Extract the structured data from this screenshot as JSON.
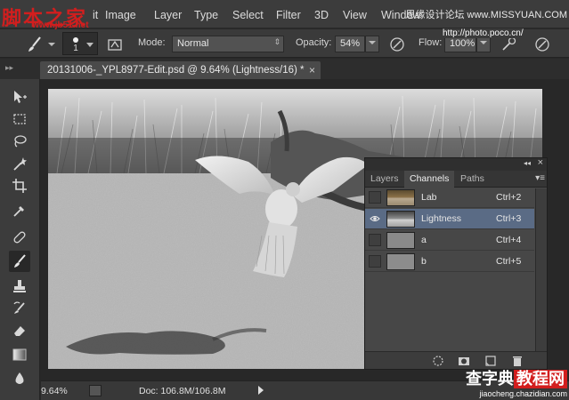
{
  "watermark": {
    "logo": "脚本之家",
    "url": "www.jb51.net",
    "top_right": "思缘设计论坛 www.MISSYUAN.COM",
    "bottom_big_prefix": "查字典",
    "bottom_big_highlight": "教程网",
    "bottom_small": "jiaocheng.chazidian.com"
  },
  "menu": {
    "items": [
      "it",
      "Image",
      "Layer",
      "Type",
      "Select",
      "Filter",
      "3D",
      "View",
      "Window"
    ]
  },
  "options": {
    "brush_size": "1",
    "mode_label": "Mode:",
    "mode_value": "Normal",
    "opacity_label": "Opacity:",
    "opacity_value": "54%",
    "flow_label": "Flow:",
    "flow_value": "100%",
    "photo_url": "http://photo.poco.cn/"
  },
  "document": {
    "tab_title": "20131006-_YPL8977-Edit.psd @ 9.64% (Lightness/16) *",
    "close": "×"
  },
  "status": {
    "zoom": "9.64%",
    "doc_info": "Doc: 106.8M/106.8M"
  },
  "panel": {
    "tabs": [
      "Layers",
      "Channels",
      "Paths"
    ],
    "active_tab": "Channels",
    "collapse": "◂◂",
    "close": "×",
    "channels": [
      {
        "name": "Lab",
        "shortcut": "Ctrl+2",
        "visible": false,
        "selected": false
      },
      {
        "name": "Lightness",
        "shortcut": "Ctrl+3",
        "visible": true,
        "selected": true
      },
      {
        "name": "a",
        "shortcut": "Ctrl+4",
        "visible": false,
        "selected": false
      },
      {
        "name": "b",
        "shortcut": "Ctrl+5",
        "visible": false,
        "selected": false
      }
    ]
  },
  "colors": {
    "selection": "#5a6b85",
    "watermark_red": "#d21e1e"
  }
}
